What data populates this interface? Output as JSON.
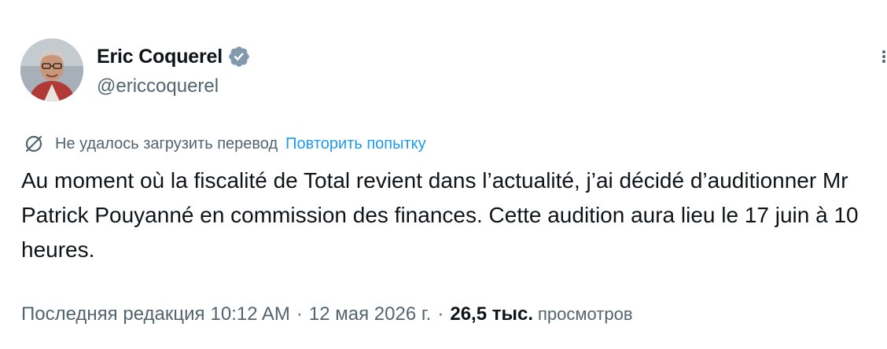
{
  "author": {
    "name": "Eric Coquerel",
    "handle": "@ericcoquerel",
    "verified_color": "#829aab"
  },
  "icons": {
    "verified": "verified-badge-icon",
    "no_translate": "translation-unavailable-icon",
    "more": "more-options-icon"
  },
  "translation": {
    "status": "Не удалось загрузить перевод",
    "retry_label": "Повторить попытку"
  },
  "tweet": {
    "text": "Au moment où la fiscalité de Total revient dans l’actualité, j’ai décidé d’auditionner Mr Patrick Pouyanné en commission des finances. Cette audition aura lieu le 17 juin à 10 heures."
  },
  "meta": {
    "edited_label": "Последняя редакция",
    "time": "10:12 AM",
    "separator": "·",
    "date": "12 мая 2026 г.",
    "views_count": "26,5 тыс.",
    "views_label": "просмотров"
  },
  "colors": {
    "text_primary": "#0f1419",
    "text_secondary": "#536471",
    "link": "#1d9bf0"
  }
}
